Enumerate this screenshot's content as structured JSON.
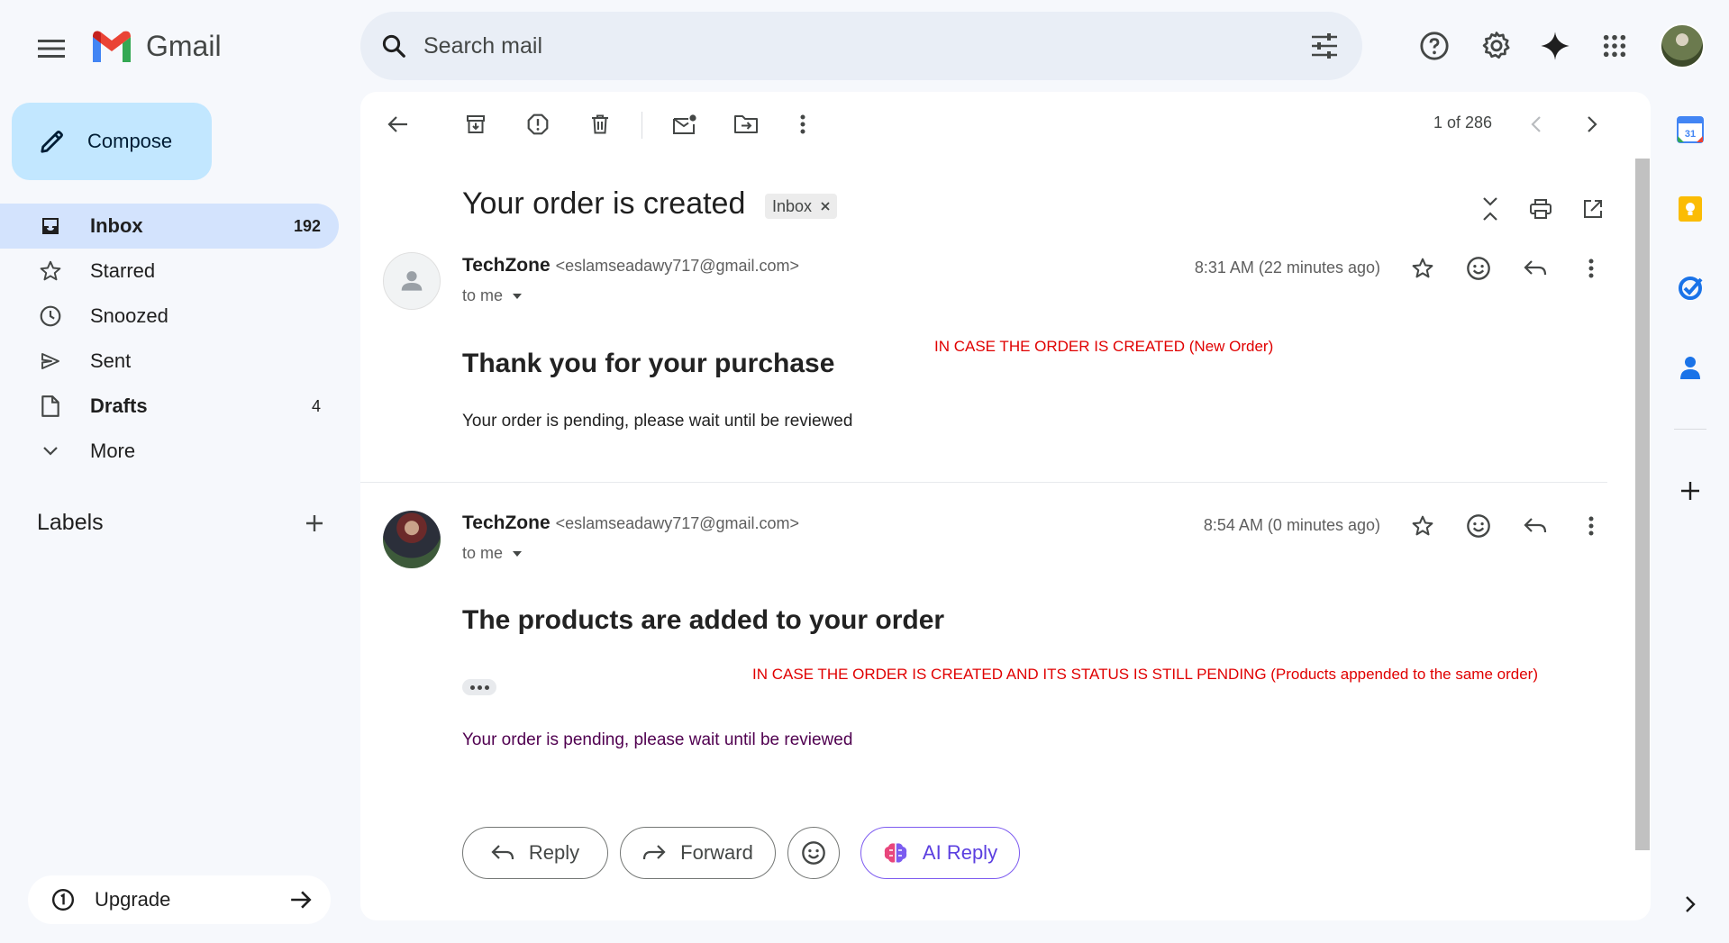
{
  "app": {
    "name": "Gmail"
  },
  "search": {
    "placeholder": "Search mail"
  },
  "compose": {
    "label": "Compose"
  },
  "nav": [
    {
      "label": "Inbox",
      "count": "192"
    },
    {
      "label": "Starred",
      "count": ""
    },
    {
      "label": "Snoozed",
      "count": ""
    },
    {
      "label": "Sent",
      "count": ""
    },
    {
      "label": "Drafts",
      "count": "4"
    },
    {
      "label": "More",
      "count": ""
    }
  ],
  "labels": {
    "title": "Labels"
  },
  "upgrade": {
    "label": "Upgrade"
  },
  "pager": {
    "text": "1 of 286"
  },
  "thread": {
    "subject": "Your order is created",
    "chip": "Inbox",
    "messages": [
      {
        "sender": "TechZone",
        "email": "<eslamseadawy717@gmail.com>",
        "to": "to me",
        "time": "8:31 AM (22 minutes ago)",
        "heading": "Thank you for your purchase",
        "body": "Your order is pending, please wait until be reviewed",
        "annotation": "IN CASE THE ORDER IS CREATED (New Order)"
      },
      {
        "sender": "TechZone",
        "email": "<eslamseadawy717@gmail.com>",
        "to": "to me",
        "time": "8:54 AM (0 minutes ago)",
        "heading": "The products are added to your order",
        "body": "Your order is pending, please wait until be reviewed",
        "annotation": "IN CASE THE ORDER IS CREATED AND ITS STATUS IS STILL PENDING (Products appended to the same order)"
      }
    ]
  },
  "actions": {
    "reply": "Reply",
    "forward": "Forward",
    "ai_reply": "AI Reply"
  },
  "side_apps": {
    "calendar_day": "31"
  },
  "colors": {
    "accent": "#0b57d0",
    "compose_bg": "#c2e7ff",
    "active_nav": "#d3e3fd",
    "annotation": "#e00000"
  }
}
